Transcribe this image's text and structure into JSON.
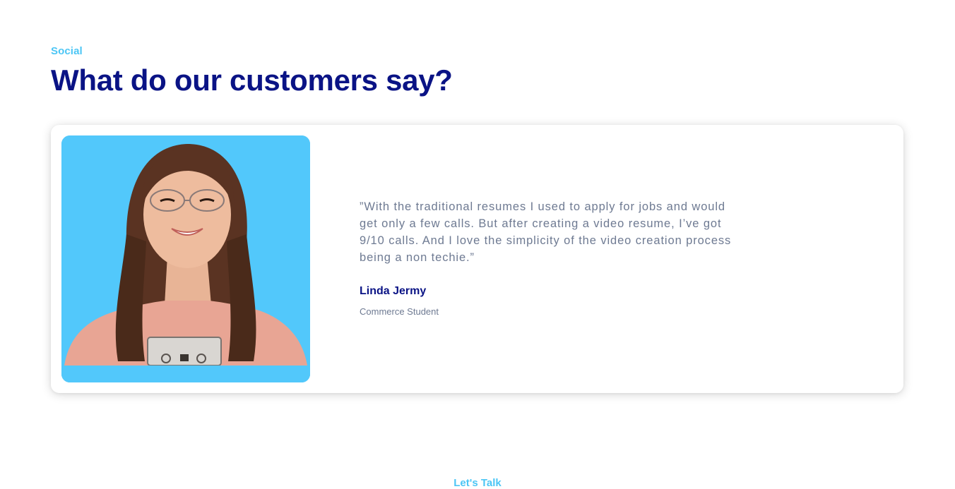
{
  "testimonials": {
    "eyebrow": "Social",
    "title": "What do our customers say?",
    "items": [
      {
        "quote": "”With the traditional resumes I used to apply for jobs and would get only a few calls. But after creating a video resume, I’ve got 9/10 calls. And I love the simplicity of the video creation process being a non techie.”",
        "name": "Linda Jermy",
        "role": "Commerce Student",
        "photo_bg": "#52c8fb"
      }
    ]
  },
  "next_section": {
    "eyebrow": "Let's Talk"
  },
  "colors": {
    "accent": "#4cc6f5",
    "heading": "#0a1385",
    "body_text": "#6e7a92"
  }
}
